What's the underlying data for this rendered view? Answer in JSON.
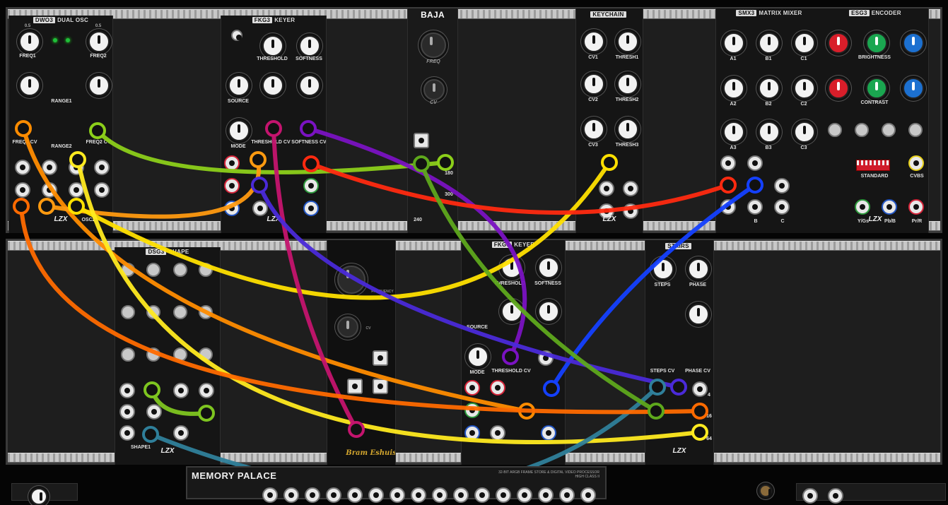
{
  "modules": {
    "dwo3": {
      "tag": "DWO3",
      "title": "DUAL OSC",
      "labels": [
        "FREQ1",
        "FREQ2",
        "RANGE1",
        "RANGE2",
        "FREQ1 CV",
        "FREQ2 CV",
        "OSC2",
        "RST",
        "A",
        "B"
      ],
      "scale": [
        "0.5",
        "0.5",
        "0",
        "0"
      ]
    },
    "fkg3a": {
      "tag": "FKG3",
      "title": "KEYER",
      "labels": [
        "THRESHOLD",
        "SOFTNESS",
        "SOURCE",
        "MODE",
        "THRESHOLD CV",
        "SOFTNESS CV"
      ]
    },
    "baja": {
      "title": "BAJA",
      "labels": [
        "FREQ",
        "CV",
        "180",
        "300",
        "240",
        "CV"
      ]
    },
    "keychain": {
      "title": "KEYCHAIN",
      "labels": [
        "CV1",
        "THRESH1",
        "CV2",
        "THRESH2",
        "CV3",
        "THRESH3"
      ]
    },
    "smx3": {
      "tag": "SMX3",
      "title": "MATRIX MIXER",
      "labels": [
        "A1",
        "B1",
        "C1",
        "A2",
        "B2",
        "C2",
        "A3",
        "B3",
        "C3",
        "A",
        "B",
        "C"
      ]
    },
    "esg3": {
      "tag": "ESG3",
      "title": "ENCODER",
      "labels": [
        "BRIGHTNESS",
        "CONTRAST",
        "STANDARD",
        "CVBS",
        "Y/Gs",
        "Pb/B",
        "Pr/R"
      ],
      "scale": [
        "0",
        "32",
        "0",
        "32"
      ]
    },
    "dsg": {
      "tag": "DSG3",
      "title": "SHAPE",
      "labels": [
        "SHAPE1"
      ]
    },
    "bm": {
      "title": "",
      "labels": [
        "FREQUENCY",
        "CV"
      ],
      "signature": "Bram Eshuis"
    },
    "fkg3b": {
      "tag": "FKG3",
      "title": "KEYER",
      "labels": [
        "THRESHOLD",
        "SOFTNESS",
        "SOURCE",
        "MODE",
        "THRESHOLD CV",
        "SOFTNESS CV"
      ]
    },
    "stairs": {
      "title": "STAIRS",
      "labels": [
        "STEPS",
        "PHASE",
        "STEPS CV",
        "PHASE CV",
        "2",
        "4",
        "8",
        "16",
        "32",
        "64"
      ],
      "scale": [
        "64",
        "0.5"
      ]
    },
    "memory": {
      "title": "MEMORY PALACE",
      "subtitle": "32-BIT ARGB FRAME STORE & DIGITAL VIDEO PROCESSOR",
      "subtitle2": "HIGH CLASS II"
    }
  },
  "brand": "LZX",
  "colors": {
    "rack": "#1e1e1e",
    "rail": "#b5b5b5",
    "panel": "#151515",
    "accent_red": "#d81e2a",
    "accent_green": "#1aa650",
    "accent_blue": "#1c70d0"
  },
  "cables": [
    {
      "name": "cable-green-1",
      "color": "#8ccf1a"
    },
    {
      "name": "cable-orange-1",
      "color": "#ff8c00"
    },
    {
      "name": "cable-orange-2",
      "color": "#ff9a10"
    },
    {
      "name": "cable-yellow-1",
      "color": "#ffe000"
    },
    {
      "name": "cable-yellow-2",
      "color": "#ffea20"
    },
    {
      "name": "cable-magenta-1",
      "color": "#c4146e"
    },
    {
      "name": "cable-purple-1",
      "color": "#7a12c2"
    },
    {
      "name": "cable-red-1",
      "color": "#ff2a10"
    },
    {
      "name": "cable-blue-1",
      "color": "#1440ff"
    },
    {
      "name": "cable-violet-1",
      "color": "#4a2ad8"
    },
    {
      "name": "cable-teal-1",
      "color": "#2f7f9a"
    },
    {
      "name": "cable-lime-1",
      "color": "#7ec520"
    },
    {
      "name": "cable-orange-3",
      "color": "#ff6a00"
    },
    {
      "name": "cable-olive-1",
      "color": "#5ea81c"
    }
  ]
}
